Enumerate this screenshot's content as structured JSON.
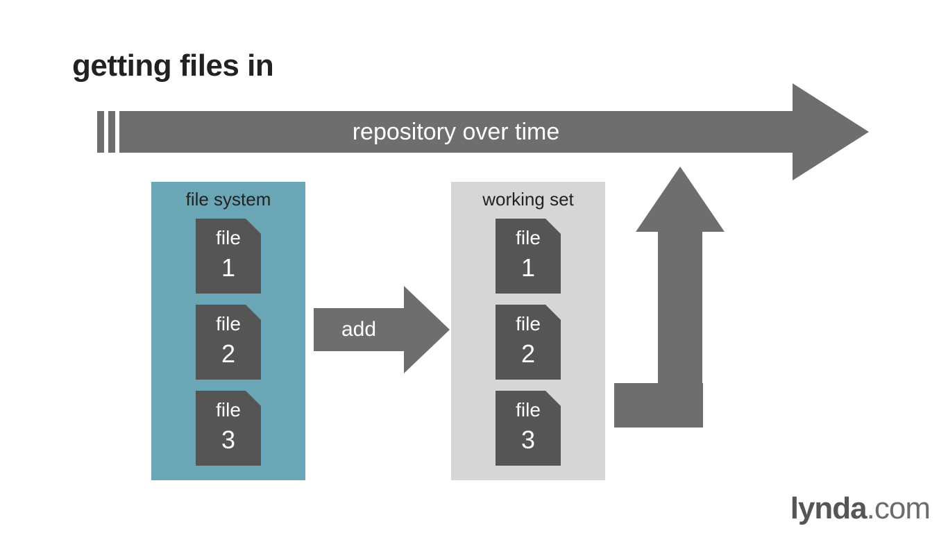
{
  "title": "getting files in",
  "timeline_label": "repository over time",
  "file_system": {
    "title": "file system",
    "files": [
      {
        "label": "file",
        "num": "1"
      },
      {
        "label": "file",
        "num": "2"
      },
      {
        "label": "file",
        "num": "3"
      }
    ]
  },
  "add_label": "add",
  "working_set": {
    "title": "working set",
    "files": [
      {
        "label": "file",
        "num": "1"
      },
      {
        "label": "file",
        "num": "2"
      },
      {
        "label": "file",
        "num": "3"
      }
    ]
  },
  "brand": {
    "name": "lynda",
    "tld": ".com"
  }
}
